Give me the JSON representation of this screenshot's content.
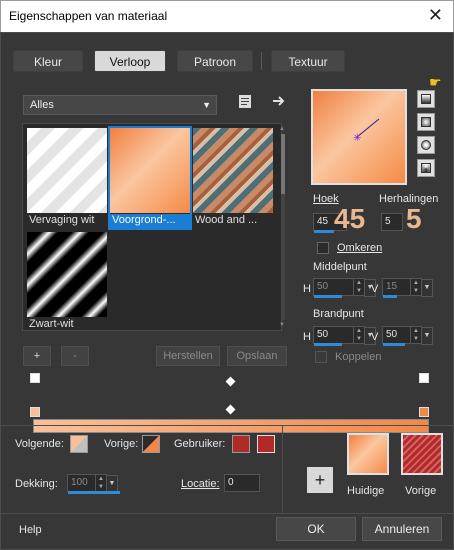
{
  "window": {
    "title": "Eigenschappen van materiaal",
    "close_glyph": "✕"
  },
  "tabs": [
    {
      "label": "Kleur"
    },
    {
      "label": "Verloop"
    },
    {
      "label": "Patroon"
    },
    {
      "label": "Textuur"
    }
  ],
  "library": {
    "category": "Alles",
    "items": [
      {
        "label": "Vervaging wit"
      },
      {
        "label": "Voorgrond-..."
      },
      {
        "label": "Wood and ..."
      },
      {
        "label": "Zwart-wit"
      }
    ],
    "selected_index": 1
  },
  "buttons": {
    "add": "+",
    "remove": "-",
    "restore": "Herstellen",
    "save": "Opslaan",
    "ok": "OK",
    "cancel": "Annuleren",
    "help": "Help",
    "add_swatch": "+"
  },
  "angle": {
    "label": "Hoek",
    "value": "45",
    "big": "45"
  },
  "repeats": {
    "label": "Herhalingen",
    "value": "5",
    "big": "5"
  },
  "invert": {
    "label": "Omkeren",
    "checked": false
  },
  "center": {
    "label": "Middelpunt",
    "h_label": "H",
    "h": "50",
    "v_label": "V",
    "v": "15"
  },
  "focal": {
    "label": "Brandpunt",
    "h_label": "H",
    "h": "50",
    "v_label": "V",
    "v": "50"
  },
  "link": {
    "label": "Koppelen",
    "checked": false
  },
  "stops": {
    "next_label": "Volgende:",
    "prev_label": "Vorige:",
    "user_label": "Gebruiker:",
    "opacity_label": "Dekking:",
    "opacity": "100",
    "location_label": "Locatie:",
    "location": "0"
  },
  "swatches": {
    "current_label": "Huidige",
    "previous_label": "Vorige"
  },
  "colors": {
    "accent": "#1a7fd4",
    "orange_light": "#f8c09a",
    "orange": "#f0884a",
    "user_red": "#b02a2a"
  }
}
